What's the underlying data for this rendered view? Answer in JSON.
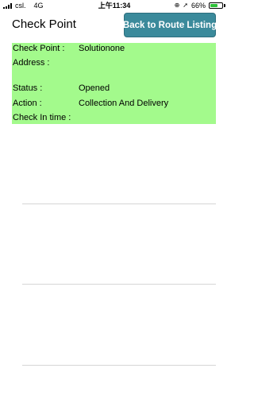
{
  "status_bar": {
    "carrier": "csl.",
    "network": "4G",
    "time": "上午11:34",
    "battery": "66%",
    "battery_level": 0.66
  },
  "header": {
    "title": "Check Point",
    "back_button_label": "Back to Route Listing"
  },
  "info": {
    "checkpoint_label": "Check Point :",
    "checkpoint_value": "Solutionone",
    "address_label": "Address :",
    "address_value": "",
    "status_label": "Status :",
    "status_value": "Opened",
    "action_label": "Action :",
    "action_value": "Collection And Delivery",
    "checkin_label": "Check In time :",
    "checkin_value": ""
  },
  "colors": {
    "panel_bg": "#a3fa8c",
    "button_bg": "#3b8a9b",
    "battery": "#2fc13a"
  }
}
